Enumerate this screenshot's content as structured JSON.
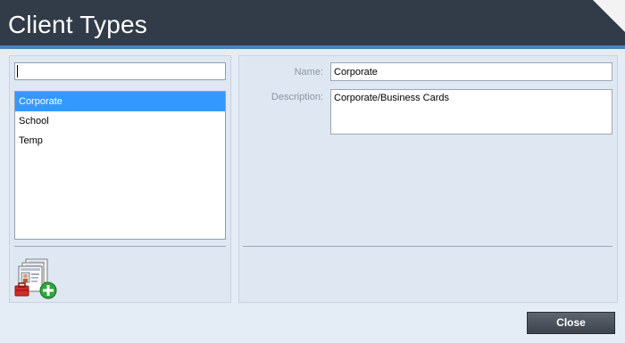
{
  "window": {
    "title": "Client Types"
  },
  "search": {
    "value": "",
    "placeholder": ""
  },
  "client_types": {
    "items": [
      {
        "label": "Corporate",
        "selected": true
      },
      {
        "label": "School",
        "selected": false
      },
      {
        "label": "Temp",
        "selected": false
      }
    ],
    "add_icon": "add-client-type-icon"
  },
  "details": {
    "name_label": "Name:",
    "name_value": "Corporate",
    "description_label": "Description:",
    "description_value": "Corporate/Business Cards"
  },
  "footer": {
    "close_label": "Close"
  },
  "colors": {
    "titlebar": "#323b48",
    "accent": "#4d81bd",
    "background": "#e4ecf6",
    "selection": "#3399ff"
  }
}
